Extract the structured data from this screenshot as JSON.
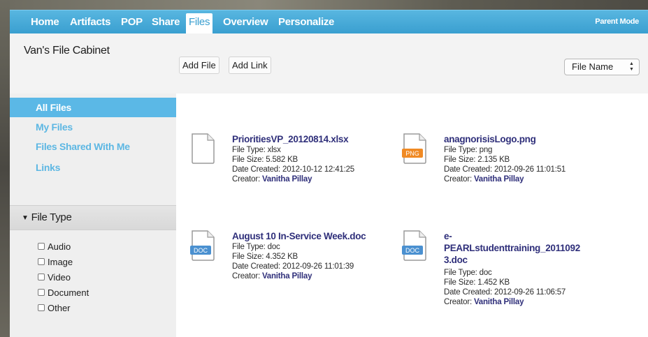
{
  "nav": {
    "items": [
      "Home",
      "Artifacts",
      "POP",
      "Share",
      "Files",
      "Overview",
      "Personalize"
    ],
    "active": "Files",
    "parent_mode": "Parent Mode"
  },
  "toolbar": {
    "cabinet_title": "Van's File Cabinet",
    "add_file": "Add File",
    "add_link": "Add Link",
    "sort_value": "File Name"
  },
  "sidebar": {
    "links": [
      "All Files",
      "My Files",
      "Files Shared With Me",
      "Links"
    ],
    "active": "All Files",
    "filetype_header": "File Type",
    "filters": [
      "Audio",
      "Image",
      "Video",
      "Document",
      "Other"
    ]
  },
  "labels": {
    "file_type": "File Type:",
    "file_size": "File Size:",
    "date_created": "Date Created:",
    "creator": "Creator:"
  },
  "files": [
    {
      "name": "PrioritiesVP_20120814.xlsx",
      "icon": "blank-doc-icon",
      "badge": "",
      "type": "xlsx",
      "size": "5.582 KB",
      "date": "2012-10-12 12:41:25",
      "creator": "Vanitha Pillay"
    },
    {
      "name": "anagnorisisLogo.png",
      "icon": "png-file-icon",
      "badge": "PNG",
      "type": "png",
      "size": "2.135 KB",
      "date": "2012-09-26 11:01:51",
      "creator": "Vanitha Pillay"
    },
    {
      "name": "August 10 In-Service Week.doc",
      "icon": "doc-file-icon",
      "badge": "DOC",
      "type": "doc",
      "size": "4.352 KB",
      "date": "2012-09-26 11:01:39",
      "creator": "Vanitha Pillay"
    },
    {
      "name": "e-PEARLstudenttraining_20110923.doc",
      "name_lines": [
        "e-",
        "PEARLstudenttraining_2011092",
        "3.doc"
      ],
      "icon": "doc-file-icon",
      "badge": "DOC",
      "type": "doc",
      "size": "1.452 KB",
      "date": "2012-09-26 11:06:57",
      "creator": "Vanitha Pillay"
    }
  ],
  "colors": {
    "nav_bar": "#3a9fd0",
    "sidebar_active": "#5bb8e6",
    "link": "#5db7e3",
    "file_name": "#2f2f7a",
    "png_badge": "#f08a24",
    "doc_badge": "#4a90d0"
  }
}
